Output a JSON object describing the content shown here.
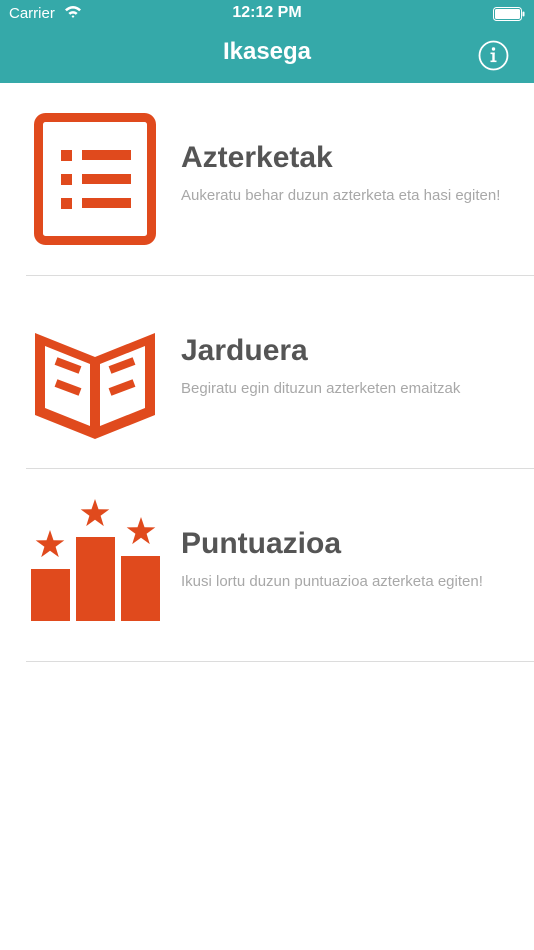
{
  "status_bar": {
    "carrier": "Carrier",
    "time": "12:12 PM"
  },
  "nav": {
    "title": "Ikasega"
  },
  "colors": {
    "header": "#35a9a9",
    "accent": "#e04a1d",
    "title_text": "#555555",
    "desc_text": "#a8a8a8"
  },
  "menu": {
    "items": [
      {
        "title": "Azterketak",
        "description": "Aukeratu behar duzun azterketa eta hasi egiten!",
        "icon": "list-icon"
      },
      {
        "title": "Jarduera",
        "description": "Begiratu egin dituzun azterketen emaitzak",
        "icon": "open-book-icon"
      },
      {
        "title": "Puntuazioa",
        "description": "Ikusi lortu duzun puntuazioa azterketa egiten!",
        "icon": "podium-stars-icon"
      }
    ]
  }
}
